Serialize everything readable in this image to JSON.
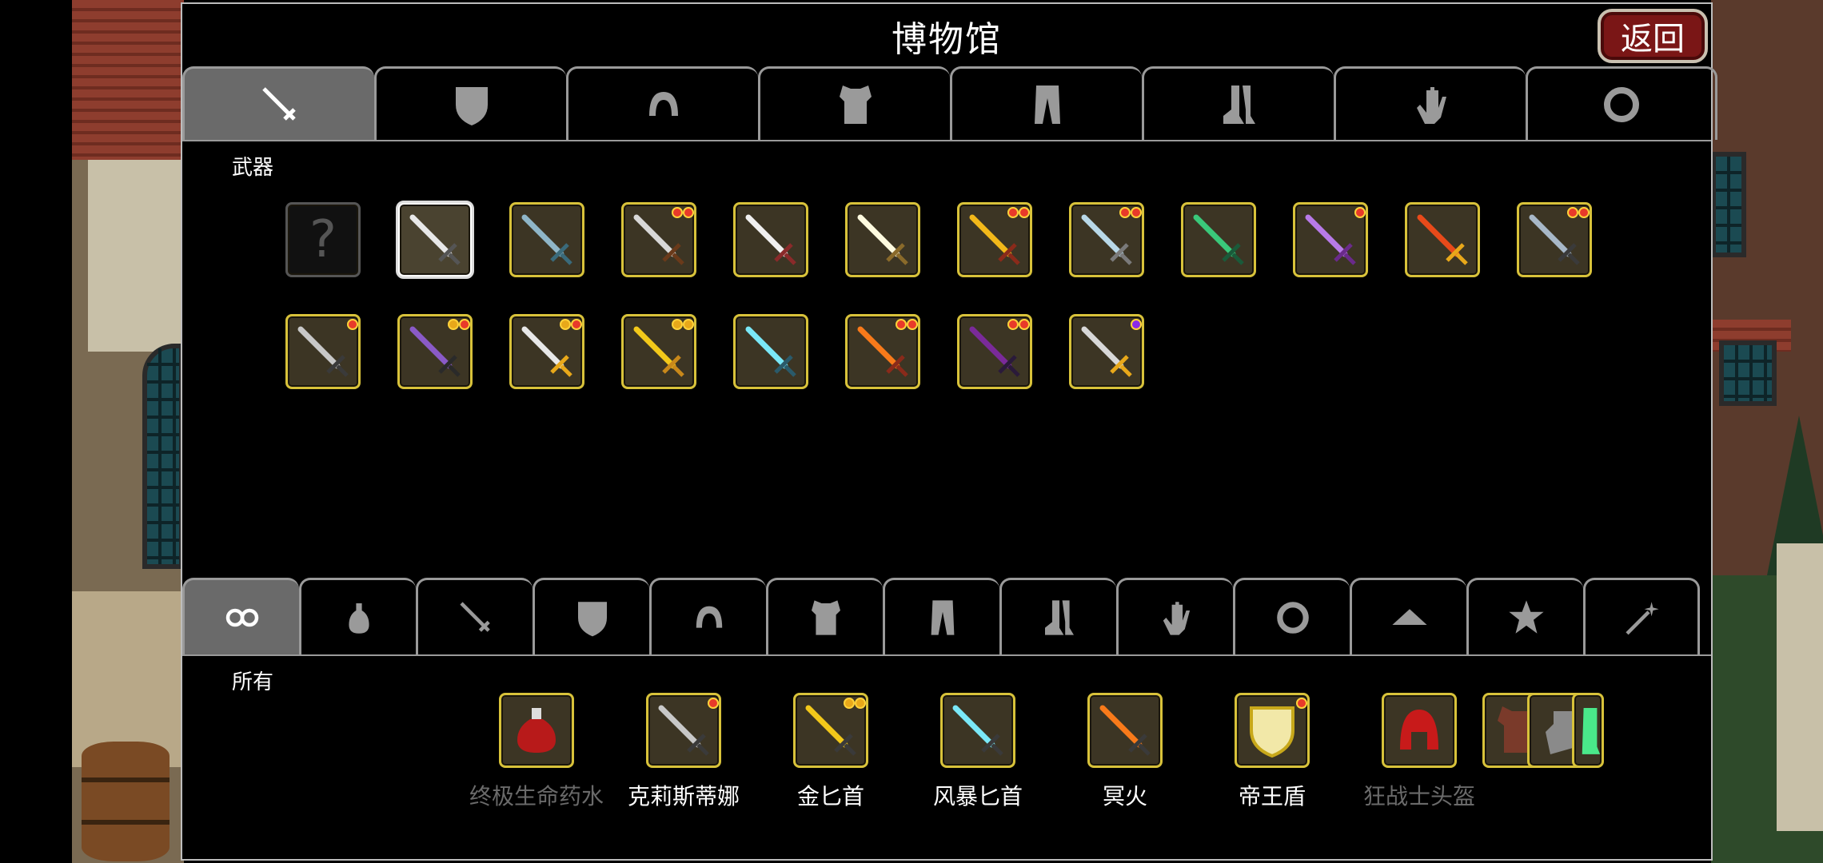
{
  "title": "博物馆",
  "back_button": "返回",
  "top_tabs": {
    "active_label": "武器",
    "icons": [
      "sword-icon",
      "shield-icon",
      "helmet-icon",
      "armor-icon",
      "pants-icon",
      "boots-icon",
      "glove-icon",
      "ring-icon"
    ]
  },
  "weapons": [
    {
      "unknown": true,
      "blade": "#777777",
      "gems": []
    },
    {
      "blade": "#e8e8e8",
      "hilt": "#555555",
      "gems": [],
      "selected": true
    },
    {
      "blade": "#8fb6c8",
      "hilt": "#3a6a7a",
      "gems": []
    },
    {
      "blade": "#d8d8d8",
      "hilt": "#6a3a1a",
      "gems": [
        "#e83a2a",
        "#e83a2a"
      ]
    },
    {
      "blade": "#f0f0f0",
      "hilt": "#8a2a2a",
      "gems": []
    },
    {
      "blade": "#fffbe0",
      "hilt": "#8a6a2a",
      "gems": []
    },
    {
      "blade": "#f2b81a",
      "hilt": "#8a2a1a",
      "gems": [
        "#e83a2a",
        "#e83a2a"
      ]
    },
    {
      "blade": "#b8d8e8",
      "hilt": "#7a7a7a",
      "gems": [
        "#e83a2a",
        "#e83a2a"
      ]
    },
    {
      "blade": "#3ac87a",
      "hilt": "#1a5a3a",
      "gems": []
    },
    {
      "blade": "#b87ae8",
      "hilt": "#6a2a8a",
      "gems": [
        "#e83a2a"
      ]
    },
    {
      "blade": "#e84a1a",
      "hilt": "#e8a81a",
      "gems": []
    },
    {
      "blade": "#a8b8c8",
      "hilt": "#3a3a3a",
      "gems": [
        "#e83a2a",
        "#e83a2a"
      ]
    },
    {
      "blade": "#c8c8c8",
      "hilt": "#3a3a3a",
      "gems": [
        "#e83a2a"
      ]
    },
    {
      "blade": "#8a5ac8",
      "hilt": "#2a2a2a",
      "gems": [
        "#e8a81a",
        "#e83a2a"
      ]
    },
    {
      "blade": "#e8e8e8",
      "hilt": "#e8a81a",
      "gems": [
        "#e8a81a",
        "#e83a2a"
      ]
    },
    {
      "blade": "#f2c81a",
      "hilt": "#c8881a",
      "gems": [
        "#e8a81a",
        "#e8a81a"
      ]
    },
    {
      "blade": "#7ae8f8",
      "hilt": "#2a5a6a",
      "gems": []
    },
    {
      "blade": "#f87a1a",
      "hilt": "#8a2a1a",
      "gems": [
        "#e83a2a",
        "#e83a2a"
      ]
    },
    {
      "blade": "#7a2a9a",
      "hilt": "#2a1a3a",
      "gems": [
        "#e83a2a",
        "#e83a2a"
      ]
    },
    {
      "blade": "#d8d8d8",
      "hilt": "#e8a81a",
      "gems": [
        "#8a2ae8"
      ]
    }
  ],
  "bottom_tabs": {
    "active_label": "所有",
    "icons": [
      "infinity-icon",
      "potion-icon",
      "sword-icon",
      "shield-icon",
      "helmet-icon",
      "armor-icon",
      "pants-icon",
      "boots-icon",
      "glove-icon",
      "ring-icon",
      "hat-icon",
      "star-icon",
      "wand-icon"
    ]
  },
  "items": [
    {
      "name": "终极生命药水",
      "dim": true,
      "kind": "potion",
      "color": "#b81a1a",
      "gems": []
    },
    {
      "name": "克莉斯蒂娜",
      "dim": false,
      "kind": "sword",
      "color": "#c8c8c8",
      "gems": [
        "#e83a2a"
      ]
    },
    {
      "name": "金匕首",
      "dim": false,
      "kind": "sword",
      "color": "#f2c81a",
      "gems": [
        "#e8a81a",
        "#e8a81a"
      ]
    },
    {
      "name": "风暴匕首",
      "dim": false,
      "kind": "sword",
      "color": "#7ae8f8",
      "gems": []
    },
    {
      "name": "冥火",
      "dim": false,
      "kind": "sword",
      "color": "#f87a1a",
      "gems": []
    },
    {
      "name": "帝王盾",
      "dim": false,
      "kind": "shield",
      "color": "#f2e8a8",
      "gems": [
        "#e83a2a"
      ]
    },
    {
      "name": "狂战士头盔",
      "dim": true,
      "kind": "helmet",
      "color": "#c81a1a",
      "gems": []
    }
  ]
}
